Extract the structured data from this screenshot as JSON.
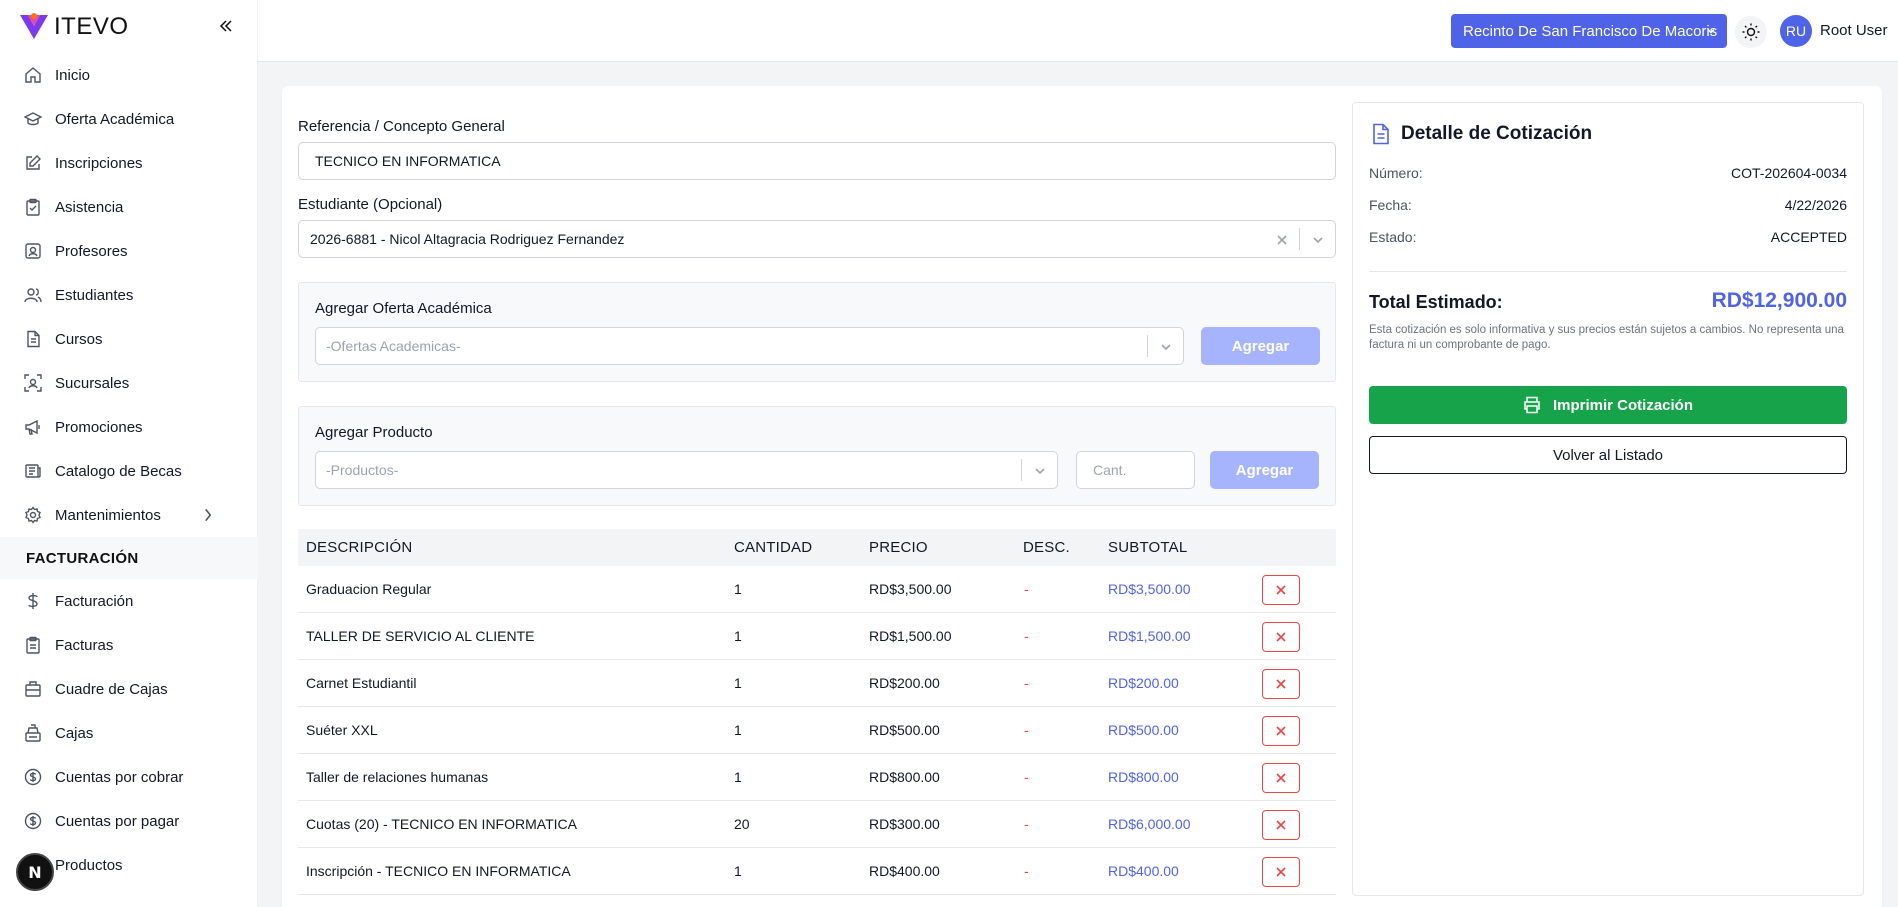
{
  "brand": {
    "name": "ITEVO"
  },
  "sidebar": {
    "items": [
      {
        "label": "Inicio",
        "icon": "home-icon"
      },
      {
        "label": "Oferta Académica",
        "icon": "graduation-cap-icon"
      },
      {
        "label": "Inscripciones",
        "icon": "edit-icon"
      },
      {
        "label": "Asistencia",
        "icon": "clipboard-icon"
      },
      {
        "label": "Profesores",
        "icon": "id-badge-icon"
      },
      {
        "label": "Estudiantes",
        "icon": "users-icon"
      },
      {
        "label": "Cursos",
        "icon": "document-icon"
      },
      {
        "label": "Sucursales",
        "icon": "scan-icon"
      },
      {
        "label": "Promociones",
        "icon": "megaphone-icon"
      },
      {
        "label": "Catalogo de Becas",
        "icon": "newspaper-icon"
      },
      {
        "label": "Mantenimientos",
        "icon": "gear-icon"
      }
    ],
    "section_title": "FACTURACIÓN",
    "billing_items": [
      {
        "label": "Facturación",
        "icon": "dollar-icon"
      },
      {
        "label": "Facturas",
        "icon": "receipt-icon"
      },
      {
        "label": "Cuadre de Cajas",
        "icon": "briefcase-icon"
      },
      {
        "label": "Cajas",
        "icon": "cash-register-icon"
      },
      {
        "label": "Cuentas por cobrar",
        "icon": "coin-icon"
      },
      {
        "label": "Cuentas por pagar",
        "icon": "coin-icon"
      },
      {
        "label": "Productos",
        "icon": "box-icon"
      }
    ],
    "next_badge": "N"
  },
  "topbar": {
    "branch": "Recinto De San Francisco De Macoris",
    "avatar_initials": "RU",
    "user_name": "Root User"
  },
  "form": {
    "reference_label": "Referencia / Concepto General",
    "reference_value": "TECNICO EN INFORMATICA",
    "student_label": "Estudiante (Opcional)",
    "student_value": "2026-6881 - Nicol Altagracia Rodriguez Fernandez",
    "offer_panel_title": "Agregar Oferta Académica",
    "offer_placeholder": "-Ofertas Academicas-",
    "offer_button": "Agregar",
    "product_panel_title": "Agregar Producto",
    "product_placeholder": "-Productos-",
    "quantity_placeholder": "Cant.",
    "product_button": "Agregar"
  },
  "table": {
    "headers": [
      "DESCRIPCIÓN",
      "CANTIDAD",
      "PRECIO",
      "DESC.",
      "SUBTOTAL"
    ],
    "rows": [
      {
        "description": "Graduacion Regular",
        "quantity": "1",
        "price": "RD$3,500.00",
        "discount": "-",
        "subtotal": "RD$3,500.00"
      },
      {
        "description": "TALLER DE SERVICIO AL CLIENTE",
        "quantity": "1",
        "price": "RD$1,500.00",
        "discount": "-",
        "subtotal": "RD$1,500.00"
      },
      {
        "description": "Carnet Estudiantil",
        "quantity": "1",
        "price": "RD$200.00",
        "discount": "-",
        "subtotal": "RD$200.00"
      },
      {
        "description": "Suéter XXL",
        "quantity": "1",
        "price": "RD$500.00",
        "discount": "-",
        "subtotal": "RD$500.00"
      },
      {
        "description": "Taller de relaciones humanas",
        "quantity": "1",
        "price": "RD$800.00",
        "discount": "-",
        "subtotal": "RD$800.00"
      },
      {
        "description": "Cuotas (20) - TECNICO EN INFORMATICA",
        "quantity": "20",
        "price": "RD$300.00",
        "discount": "-",
        "subtotal": "RD$6,000.00"
      },
      {
        "description": "Inscripción - TECNICO EN INFORMATICA",
        "quantity": "1",
        "price": "RD$400.00",
        "discount": "-",
        "subtotal": "RD$400.00"
      }
    ]
  },
  "detail": {
    "title": "Detalle de Cotización",
    "number_label": "Número:",
    "number_value": "COT-202604-0034",
    "date_label": "Fecha:",
    "date_value": "4/22/2026",
    "status_label": "Estado:",
    "status_value": "ACCEPTED",
    "total_label": "Total Estimado:",
    "total_value": "RD$12,900.00",
    "note": "Esta cotización es solo informativa y sus precios están sujetos a cambios. No representa una factura ni un comprobante de pago.",
    "print_button": "Imprimir Cotización",
    "back_button": "Volver al Listado"
  },
  "colors": {
    "primary": "#4f63e8",
    "success": "#16a34a",
    "danger": "#ef4444",
    "disabled": "#a5b4fc"
  }
}
